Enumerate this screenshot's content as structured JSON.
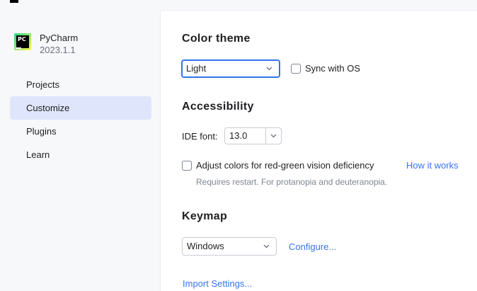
{
  "app": {
    "name": "PyCharm",
    "version": "2023.1.1",
    "logo_text": "PC"
  },
  "sidebar": {
    "items": [
      {
        "label": "Projects"
      },
      {
        "label": "Customize"
      },
      {
        "label": "Plugins"
      },
      {
        "label": "Learn"
      }
    ],
    "active": "Customize"
  },
  "color_theme": {
    "title": "Color theme",
    "selected": "Light",
    "sync_label": "Sync with OS",
    "sync_checked": false
  },
  "accessibility": {
    "title": "Accessibility",
    "ide_font_label": "IDE font:",
    "ide_font_value": "13.0",
    "adjust_colors_label": "Adjust colors for red-green vision deficiency",
    "adjust_colors_checked": false,
    "how_it_works_link": "How it works",
    "restart_hint": "Requires restart. For protanopia and deuteranopia."
  },
  "keymap": {
    "title": "Keymap",
    "selected": "Windows",
    "configure_link": "Configure..."
  },
  "import_settings_link": "Import Settings...",
  "colors": {
    "accent": "#3574f0",
    "active_nav_bg": "#dfe6fc",
    "sidebar_bg": "#f7f8fa"
  }
}
